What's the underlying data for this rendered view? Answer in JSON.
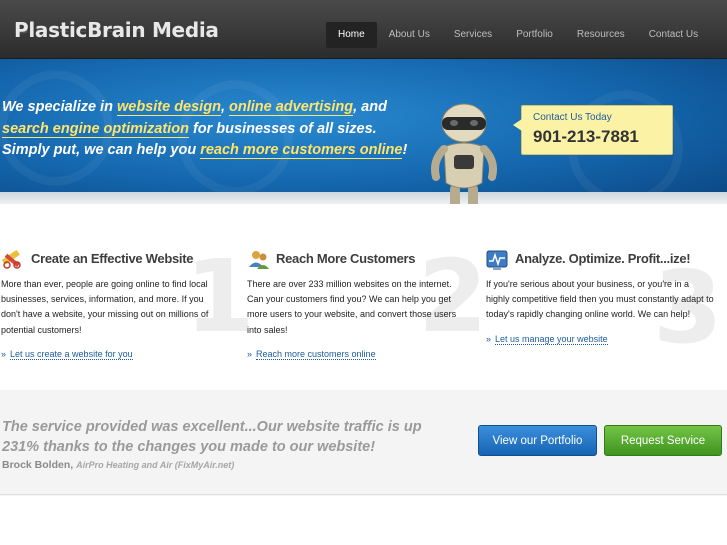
{
  "header": {
    "logo": "PlasticBrain Media",
    "nav": [
      {
        "label": "Home",
        "active": true
      },
      {
        "label": "About Us",
        "active": false
      },
      {
        "label": "Services",
        "active": false
      },
      {
        "label": "Portfolio",
        "active": false
      },
      {
        "label": "Resources",
        "active": false
      },
      {
        "label": "Contact Us",
        "active": false
      }
    ]
  },
  "hero": {
    "t1": "We specialize in ",
    "hl1": "website design",
    "t2": ", ",
    "hl2": "online advertising",
    "t3": ", and ",
    "hl3": "search engine optimization",
    "t4": " for businesses of all sizes. Simply put, we can help you ",
    "hl4": "reach more customers online",
    "t5": "!",
    "contact_label": "Contact Us Today",
    "contact_phone": "901-213-7881"
  },
  "features": [
    {
      "number": "1",
      "icon": "pencil-ruler-icon",
      "title": "Create an Effective Website",
      "body": "More than ever, people are going online to find local businesses, services, information, and more. If you don't have a website, your missing out on millions of potential customers!",
      "link": "Let us create a website for you"
    },
    {
      "number": "2",
      "icon": "users-icon",
      "title": "Reach More Customers",
      "body": "There are over 233 million websites on the internet. Can your customers find you? We can help you get more users to your website, and convert those users into sales!",
      "link": "Reach more customers online"
    },
    {
      "number": "3",
      "icon": "analytics-icon",
      "title": "Analyze. Optimize. Profit...ize!",
      "body": "If you're serious about your business, or you're in a highly competitive field then you must constantly adapt to today's rapidly changing online world. We can help!",
      "link": "Let us manage your website"
    }
  ],
  "testimonial": {
    "quote": "The service provided was excellent...Our website traffic is up 231% thanks to the changes you made to our website!",
    "author": "Brock Bolden, ",
    "company": "AirPro Heating and Air (FixMyAir.net)"
  },
  "buttons": {
    "portfolio": "View our Portfolio",
    "request": "Request Service"
  },
  "colors": {
    "hero_blue": "#1466ad",
    "highlight": "#ffe46a",
    "link_blue": "#1b5c9c",
    "btn_blue": "#1764b4",
    "btn_green": "#3f9420"
  }
}
